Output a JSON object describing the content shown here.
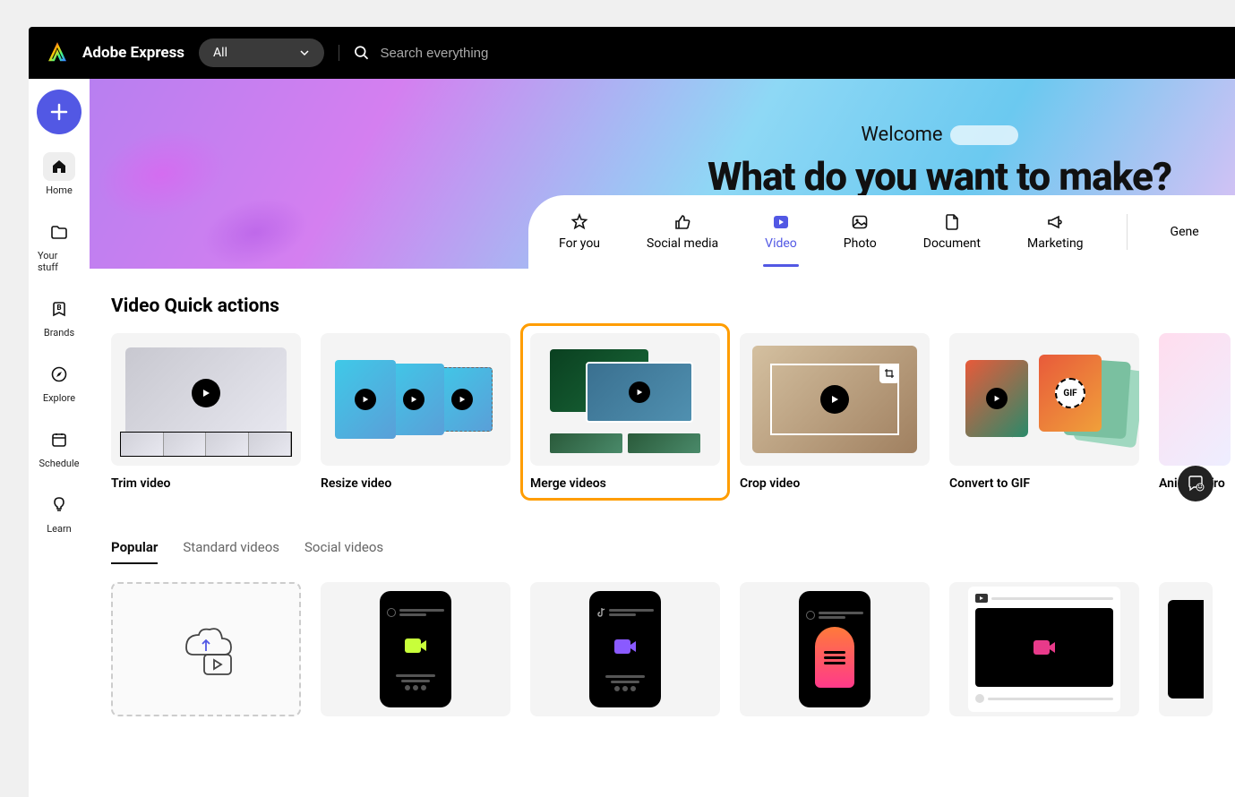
{
  "app": {
    "title": "Adobe Express"
  },
  "topbar": {
    "filter_label": "All",
    "search_placeholder": "Search everything"
  },
  "sidebar": {
    "items": [
      {
        "label": "Home",
        "icon": "home-icon",
        "active": true
      },
      {
        "label": "Your stuff",
        "icon": "folder-icon"
      },
      {
        "label": "Brands",
        "icon": "brand-icon"
      },
      {
        "label": "Explore",
        "icon": "compass-icon"
      },
      {
        "label": "Schedule",
        "icon": "calendar-icon"
      },
      {
        "label": "Learn",
        "icon": "lightbulb-icon"
      }
    ]
  },
  "hero": {
    "welcome": "Welcome",
    "headline": "What do you want to make?"
  },
  "categories": [
    {
      "label": "For you",
      "icon": "star-icon"
    },
    {
      "label": "Social media",
      "icon": "thumbsup-icon"
    },
    {
      "label": "Video",
      "icon": "play-square-icon",
      "active": true
    },
    {
      "label": "Photo",
      "icon": "image-icon"
    },
    {
      "label": "Document",
      "icon": "file-icon"
    },
    {
      "label": "Marketing",
      "icon": "megaphone-icon"
    },
    {
      "label": "Gene"
    }
  ],
  "quick_actions": {
    "title": "Video Quick actions",
    "items": [
      {
        "label": "Trim video"
      },
      {
        "label": "Resize video"
      },
      {
        "label": "Merge videos",
        "highlighted": true
      },
      {
        "label": "Crop video"
      },
      {
        "label": "Convert to GIF",
        "gif_badge": "GIF"
      },
      {
        "label": "Animate fro"
      }
    ]
  },
  "template_tabs": [
    {
      "label": "Popular",
      "active": true
    },
    {
      "label": "Standard videos"
    },
    {
      "label": "Social videos"
    }
  ]
}
